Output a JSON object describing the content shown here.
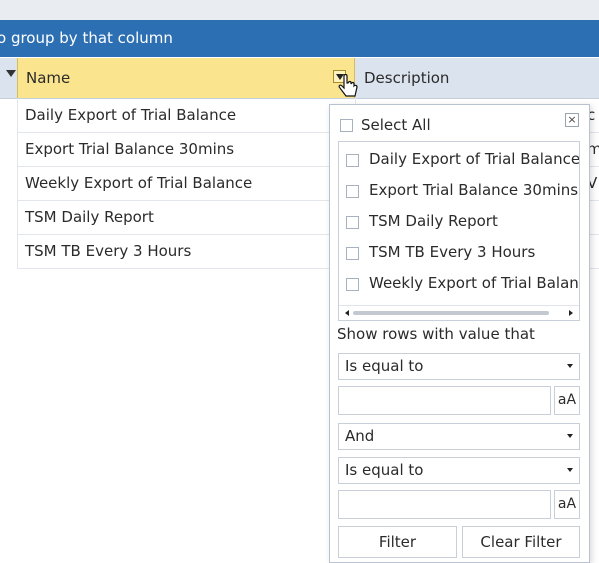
{
  "group_bar": {
    "text": "o group by that column"
  },
  "grid": {
    "columns": {
      "name": "Name",
      "description": "Description"
    },
    "rows": [
      {
        "name": "Daily Export of Trial Balance",
        "desc_fragment": "c"
      },
      {
        "name": "Export Trial Balance 30mins",
        "desc_fragment": "m"
      },
      {
        "name": "Weekly Export of Trial Balance",
        "desc_fragment": "V"
      },
      {
        "name": "TSM Daily Report",
        "desc_fragment": ""
      },
      {
        "name": "TSM TB Every 3 Hours",
        "desc_fragment": ""
      }
    ]
  },
  "filter_popup": {
    "select_all": "Select All",
    "close": "×",
    "items": [
      "Daily Export of Trial Balance",
      "Export Trial Balance 30mins",
      "TSM Daily Report",
      "TSM TB Every 3 Hours",
      "Weekly Export of Trial Balan"
    ],
    "show_rows_label": "Show rows with value that",
    "condition1": "Is equal to",
    "value1": "",
    "case_button_1": "aA",
    "logic_operator": "And",
    "condition2": "Is equal to",
    "value2": "",
    "case_button_2": "aA",
    "filter_button": "Filter",
    "clear_filter_button": "Clear Filter"
  },
  "colors": {
    "group_bar_bg": "#2d6fb3",
    "header_bg": "#dbe3ee",
    "active_column_bg": "#fbe48e"
  }
}
